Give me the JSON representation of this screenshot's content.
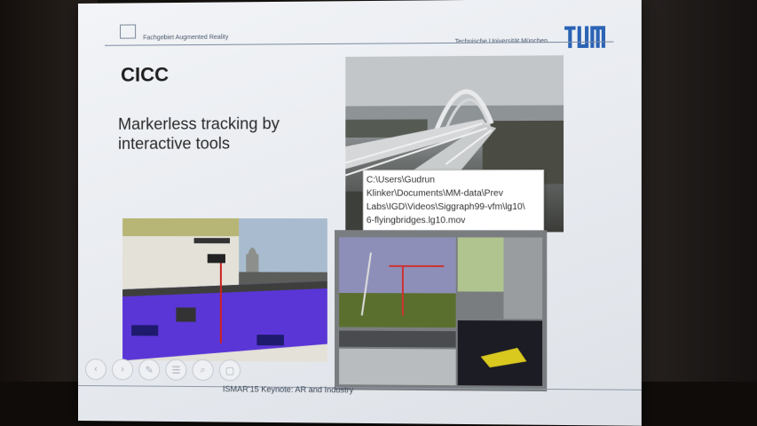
{
  "slide": {
    "header": {
      "chair_text": "Fachgebiet Augmented Reality",
      "university_text": "Technische Universität München",
      "logo_text": "TUM"
    },
    "title": "CICC",
    "subtitle_lines": [
      "Markerless tracking by",
      "interactive tools"
    ],
    "video_path_lines": [
      "C:\\Users\\Gudrun",
      "Klinker\\Documents\\MM-data\\Prev",
      "Labs\\IGD\\Videos\\Siggraph99-vfm\\lg10\\",
      "6-flyingbridges.lg10.mov"
    ],
    "footer_text": "ISMAR'15 Keynote: AR and Industry",
    "nav_icons": [
      "previous-icon",
      "next-icon",
      "edit-icon",
      "menu-icon",
      "zoom-icon",
      "end-icon"
    ]
  },
  "colors": {
    "slide_bg": "#eef0f3",
    "tum_blue": "#2b63b5",
    "rule_blue": "#7d8ba1",
    "floor_purple": "#5a36d6"
  }
}
